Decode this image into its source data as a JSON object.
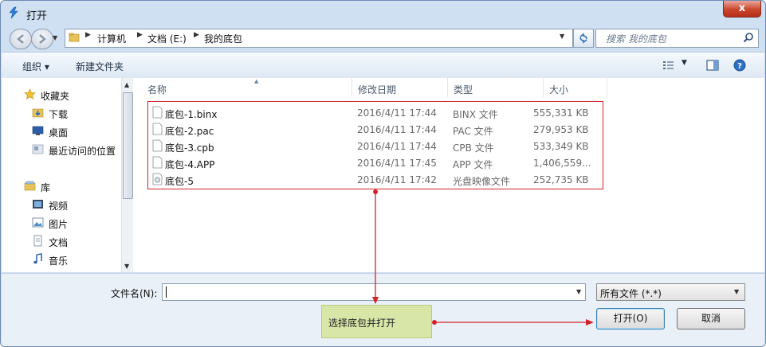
{
  "window": {
    "title": "打开",
    "close_label": "x"
  },
  "address": {
    "crumbs": [
      "计算机",
      "文档 (E:)",
      "我的底包"
    ]
  },
  "search": {
    "placeholder": "搜索 我的底包"
  },
  "toolbar": {
    "organize": "组织 ▾",
    "new_folder": "新建文件夹"
  },
  "navpane": {
    "favorites": "收藏夹",
    "fav_items": [
      "下载",
      "桌面",
      "最近访问的位置"
    ],
    "library": "库",
    "lib_items": [
      "视频",
      "图片",
      "文档",
      "音乐"
    ]
  },
  "columns": {
    "name": "名称",
    "date": "修改日期",
    "type": "类型",
    "size": "大小"
  },
  "files": [
    {
      "name": "底包-1.binx",
      "date": "2016/4/11 17:44",
      "type": "BINX 文件",
      "size": "555,331 KB"
    },
    {
      "name": "底包-2.pac",
      "date": "2016/4/11 17:44",
      "type": "PAC 文件",
      "size": "279,953 KB"
    },
    {
      "name": "底包-3.cpb",
      "date": "2016/4/11 17:44",
      "type": "CPB 文件",
      "size": "533,349 KB"
    },
    {
      "name": "底包-4.APP",
      "date": "2016/4/11 17:45",
      "type": "APP 文件",
      "size": "1,406,559..."
    },
    {
      "name": "底包-5",
      "date": "2016/4/11 17:42",
      "type": "光盘映像文件",
      "size": "252,735 KB"
    }
  ],
  "bottom": {
    "filename_label": "文件名(N):",
    "filename_value": "",
    "filter_value": "所有文件 (*.*)",
    "open_label": "打开(O)",
    "cancel_label": "取消"
  },
  "annotation": {
    "text": "选择底包并打开"
  },
  "colors": {
    "highlight": "#d3232a",
    "annotation_bg": "#d8e6a8"
  }
}
